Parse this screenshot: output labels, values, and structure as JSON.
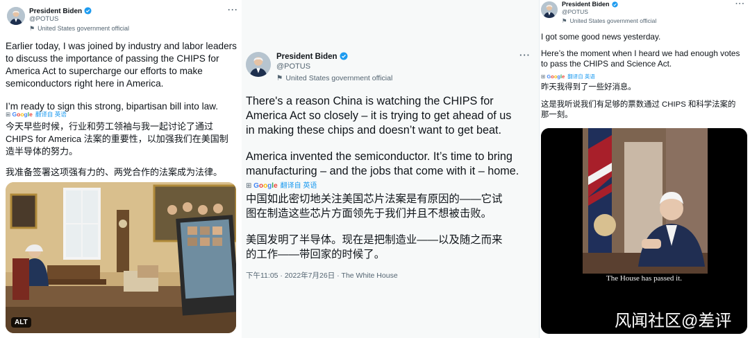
{
  "tweets": [
    {
      "name": "President Biden",
      "handle": "@POTUS",
      "gov_label": "United States government official",
      "text_lines": [
        "Earlier today, I was joined by industry and labor leaders",
        "to discuss the importance of passing the CHIPS for",
        "America Act to supercharge our efforts to make",
        "semiconductors right here in America.",
        "",
        "I’m ready to sign this strong, bipartisan bill into law."
      ],
      "translate_label": "翻译自 英语",
      "translation_lines": [
        "今天早些时候，行业和劳工领袖与我一起讨论了通过",
        "CHIPS for America 法案的重要性，以加强我们在美国制",
        "造半导体的努力。",
        "",
        "我准备签署这项强有力的、两党合作的法案成为法律。"
      ],
      "alt_badge": "ALT"
    },
    {
      "name": "President Biden",
      "handle": "@POTUS",
      "gov_label": "United States government official",
      "text_lines": [
        "There's a reason China is watching the CHIPS for",
        "America Act so closely – it is trying to get ahead of us",
        "in making these chips and doesn’t want to get beat.",
        "",
        "America invented the semiconductor. It’s time to bring",
        "manufacturing – and the jobs that come with it – home."
      ],
      "translate_label": "翻译自 英语",
      "translation_lines": [
        "中国如此密切地关注美国芯片法案是有原因的——它试",
        "图在制造这些芯片方面领先于我们并且不想被击败。",
        "",
        "美国发明了半导体。现在是把制造业——以及随之而来",
        "的工作——带回家的时候了。"
      ],
      "timestamp": "下午11:05 · 2022年7月26日 · The White House"
    },
    {
      "name": "President Biden",
      "handle": "@POTUS",
      "gov_label": "United States government official",
      "text_lines": [
        "I got some good news yesterday.",
        "",
        "Here’s the moment when I heard we had enough votes",
        "to pass the CHIPS and Science Act."
      ],
      "translate_label": "翻译自 英语",
      "translation_lines": [
        "昨天我得到了一些好消息。",
        "",
        "这是我听说我们有足够的票数通过 CHIPS 和科学法案的",
        "那一刻。"
      ],
      "video_caption": "The House has passed it."
    }
  ],
  "watermark": "风闻社区@差评",
  "colors": {
    "verified_badge": "#1d9bf0",
    "secondary_text": "#536471",
    "link": "#1d9bf0"
  },
  "icons": [
    "verified-badge-icon",
    "more-options-icon",
    "government-flag-icon",
    "google-logo-icon"
  ]
}
